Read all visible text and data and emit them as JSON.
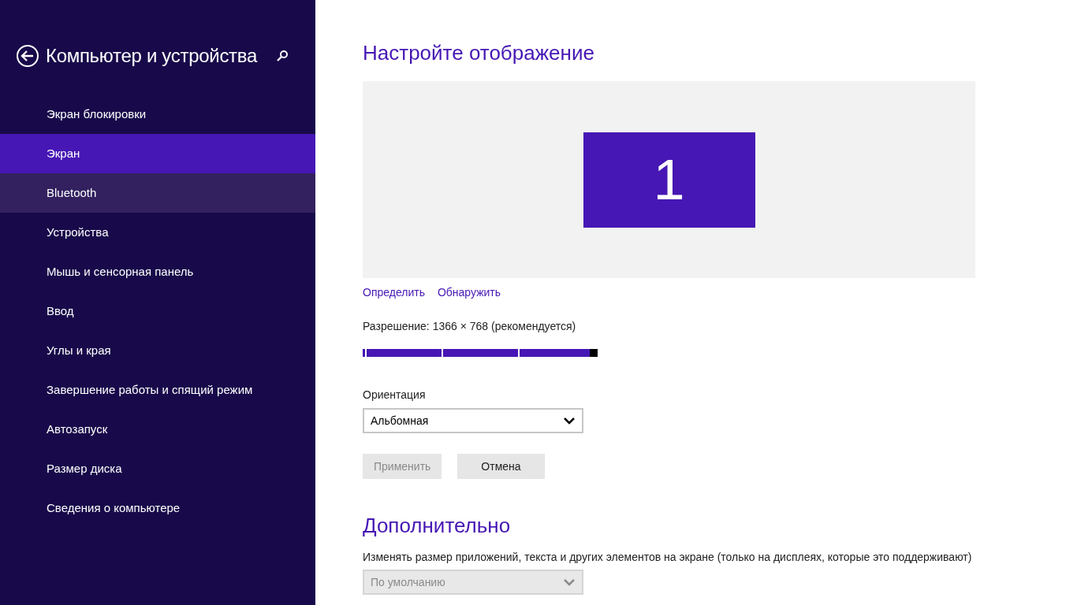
{
  "sidebar": {
    "title": "Компьютер и устройства",
    "items": [
      {
        "label": "Экран блокировки",
        "selected": false,
        "hovered": false
      },
      {
        "label": "Экран",
        "selected": true,
        "hovered": false
      },
      {
        "label": "Bluetooth",
        "selected": false,
        "hovered": true
      },
      {
        "label": "Устройства",
        "selected": false,
        "hovered": false
      },
      {
        "label": "Мышь и сенсорная панель",
        "selected": false,
        "hovered": false
      },
      {
        "label": "Ввод",
        "selected": false,
        "hovered": false
      },
      {
        "label": "Углы и края",
        "selected": false,
        "hovered": false
      },
      {
        "label": "Завершение работы и спящий режим",
        "selected": false,
        "hovered": false
      },
      {
        "label": "Автозапуск",
        "selected": false,
        "hovered": false
      },
      {
        "label": "Размер диска",
        "selected": false,
        "hovered": false
      },
      {
        "label": "Сведения о компьютере",
        "selected": false,
        "hovered": false
      }
    ]
  },
  "display": {
    "heading": "Настройте отображение",
    "monitor": "1",
    "links": [
      "Определить",
      "Обнаружить"
    ],
    "resolution": {
      "label": "Разрешение: 1366 × 768 (рекомендуется)",
      "level": 1
    },
    "orientation": {
      "label": "Ориентация",
      "value": "Альбомная",
      "disabled": false
    },
    "buttons": [
      {
        "label": "Применить",
        "disabled": true
      },
      {
        "label": "Отмена",
        "disabled": false
      }
    ]
  },
  "advanced": {
    "heading": "Дополнительно",
    "description": "Изменять размер приложений, текста и других элементов на экране (только на дисплеях, которые это поддерживают)",
    "scale": {
      "value": "По умолчанию",
      "disabled": true
    }
  }
}
